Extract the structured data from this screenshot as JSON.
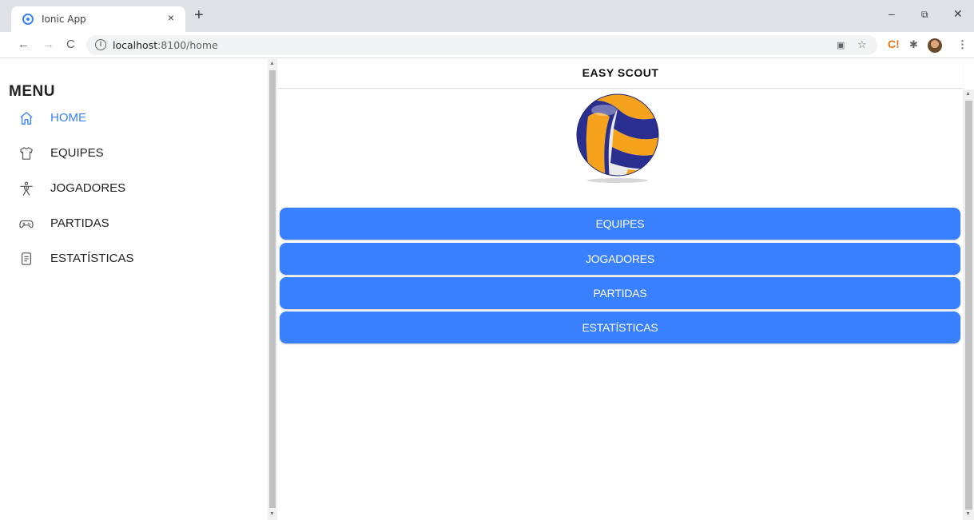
{
  "browser": {
    "tab_title": "Ionic App",
    "tab_close": "×",
    "new_tab": "+",
    "win_min": "–",
    "win_max": "⧉",
    "win_close": "✕",
    "url_host": "localhost",
    "url_path": ":8100/home",
    "icons": [
      "back-icon",
      "forward-icon",
      "reload-icon",
      "info-icon",
      "translate-icon",
      "star-icon",
      "extension-c-icon",
      "puzzle-icon",
      "profile-avatar",
      "kebab-icon"
    ]
  },
  "menu": {
    "title": "MENU",
    "accent_color": "#3880ff",
    "items": [
      {
        "label": "HOME",
        "icon": "home-icon",
        "active": true
      },
      {
        "label": "EQUIPES",
        "icon": "shirt-icon",
        "active": false
      },
      {
        "label": "JOGADORES",
        "icon": "person-icon",
        "active": false
      },
      {
        "label": "PARTIDAS",
        "icon": "gamepad-icon",
        "active": false
      },
      {
        "label": "ESTATÍSTICAS",
        "icon": "document-icon",
        "active": false
      }
    ]
  },
  "header": {
    "title": "EASY SCOUT"
  },
  "main": {
    "logo": "volleyball-icon",
    "button_color": "#3880ff",
    "buttons": [
      "EQUIPES",
      "JOGADORES",
      "PARTIDAS",
      "ESTATÍSTICAS"
    ]
  }
}
